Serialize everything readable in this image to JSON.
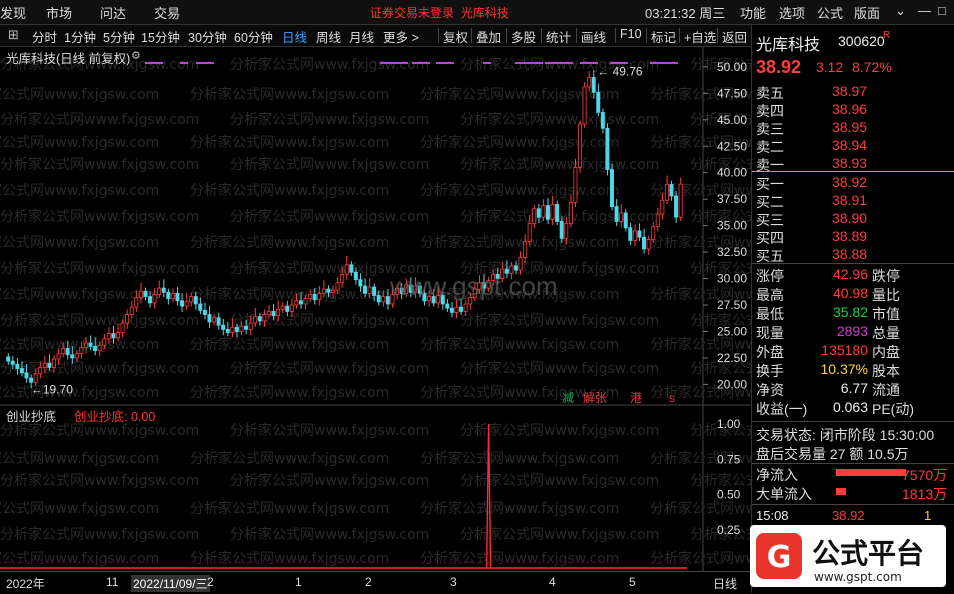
{
  "topbar": {
    "menu": [
      "发现",
      "市场",
      "问达",
      "交易"
    ],
    "warning": "证券交易未登录",
    "stock": "光库科技",
    "clock": "03:21:32 周三",
    "tools": [
      "功能",
      "选项",
      "公式",
      "版面"
    ]
  },
  "periods": [
    "分时",
    "1分钟",
    "5分钟",
    "15分钟",
    "30分钟",
    "60分钟",
    "日线",
    "周线",
    "月线",
    "更多 >"
  ],
  "active_period": "日线",
  "tools2": [
    "复权",
    "叠加",
    "多股",
    "统计",
    "画线",
    "F10",
    "标记",
    "+自选",
    "返回"
  ],
  "main_title": "光库科技(日线 前复权)",
  "indicator_title": "创业抄底",
  "indicator_value": "创业抄底: 0.00",
  "watermark": "分析家公式网www.fxjgsw.com",
  "center_watermark": "www.gspt.com",
  "chart_data": {
    "type": "candlestick",
    "price_axis": [
      50.0,
      47.5,
      45.0,
      42.5,
      40.0,
      37.5,
      35.0,
      32.5,
      30.0,
      27.5,
      25.0,
      22.5,
      20.0
    ],
    "ylim": [
      19.0,
      51.5
    ],
    "high_label": "49.76",
    "low_label": "19.70",
    "markers": [
      "减",
      "解",
      "张",
      "港",
      "s"
    ],
    "indicator_axis": [
      "1.00",
      "0.75",
      "0.50",
      "0.25",
      "0.00"
    ],
    "indicator_ylim": [
      0,
      1.0
    ],
    "x_labels": [
      "2022年",
      "11",
      "2022/11/09/三",
      "2",
      "1",
      "2",
      "3",
      "4",
      "5"
    ],
    "closes": [
      22.2,
      21.9,
      21.5,
      21.1,
      20.6,
      20.2,
      21.0,
      21.6,
      22.0,
      21.6,
      22.4,
      22.9,
      23.4,
      22.8,
      22.5,
      22.9,
      23.5,
      23.9,
      23.6,
      23.2,
      23.7,
      24.3,
      24.8,
      24.4,
      24.9,
      25.8,
      26.6,
      27.3,
      28.2,
      28.8,
      28.3,
      27.7,
      28.5,
      29.1,
      28.7,
      28.1,
      28.6,
      27.9,
      27.4,
      27.8,
      28.3,
      27.6,
      27.0,
      26.6,
      25.9,
      26.3,
      25.6,
      25.2,
      24.9,
      25.4,
      25.0,
      25.5,
      25.2,
      25.8,
      26.4,
      26.0,
      26.6,
      26.9,
      26.5,
      27.1,
      27.4,
      26.9,
      27.5,
      27.9,
      27.6,
      28.1,
      28.5,
      28.0,
      28.6,
      29.0,
      28.7,
      28.9,
      29.6,
      30.4,
      31.3,
      30.6,
      29.9,
      29.3,
      28.6,
      29.2,
      28.4,
      27.8,
      28.3,
      27.6,
      28.5,
      29.1,
      28.6,
      29.4,
      28.7,
      29.3,
      28.6,
      27.9,
      28.3,
      27.7,
      28.4,
      27.6,
      27.2,
      26.8,
      27.3,
      26.9,
      27.6,
      28.2,
      29.0,
      29.6,
      29.1,
      29.8,
      30.4,
      30.0,
      30.9,
      30.5,
      31.2,
      30.8,
      32.0,
      33.5,
      35.2,
      36.6,
      35.8,
      36.9,
      35.6,
      37.0,
      35.4,
      33.8,
      35.2,
      37.2,
      40.5,
      44.6,
      48.1,
      49.0,
      47.6,
      45.7,
      44.2,
      40.3,
      36.8,
      35.4,
      36.2,
      34.8,
      33.6,
      34.5,
      33.9,
      32.8,
      33.7,
      34.9,
      36.1,
      37.4,
      38.9,
      37.8,
      35.8,
      38.92
    ],
    "indicator_spike_index": 105,
    "indicator_spike_value": 1.0
  },
  "quote": {
    "name": "光库科技",
    "code": "300620",
    "flag": "R",
    "price": "38.92",
    "change": "3.12",
    "pct": "8.72%",
    "asks": [
      [
        "卖五",
        "38.97"
      ],
      [
        "卖四",
        "38.96"
      ],
      [
        "卖三",
        "38.95"
      ],
      [
        "卖二",
        "38.94"
      ],
      [
        "卖一",
        "38.93"
      ]
    ],
    "bids": [
      [
        "买一",
        "38.92"
      ],
      [
        "买二",
        "38.91"
      ],
      [
        "买三",
        "38.90"
      ],
      [
        "买四",
        "38.89"
      ],
      [
        "买五",
        "38.88"
      ]
    ],
    "stats": [
      [
        "涨停",
        "42.96",
        "跌停",
        ""
      ],
      [
        "最高",
        "40.98",
        "量比",
        ""
      ],
      [
        "最低",
        "35.82",
        "市值",
        ""
      ],
      [
        "现量",
        "2893",
        "总量",
        ""
      ],
      [
        "外盘",
        "135180",
        "内盘",
        ""
      ],
      [
        "换手",
        "10.37%",
        "股本",
        ""
      ],
      [
        "净资",
        "6.77",
        "流通",
        ""
      ],
      [
        "收益(一)",
        "0.063",
        "PE(动)",
        ""
      ]
    ],
    "trade_status": "交易状态: 闭市阶段 15:30:00",
    "after_hours": "盘后交易量 27 额 10.5万",
    "net_inflow_label": "净流入",
    "net_inflow": "7570万",
    "big_order_label": "大单流入",
    "big_order": "1813万",
    "ticks": [
      [
        "15:08",
        "38.92",
        "1"
      ]
    ],
    "side_tab": "日线"
  },
  "logo": {
    "text": "公式平台",
    "sub": "www.gspt.com"
  }
}
